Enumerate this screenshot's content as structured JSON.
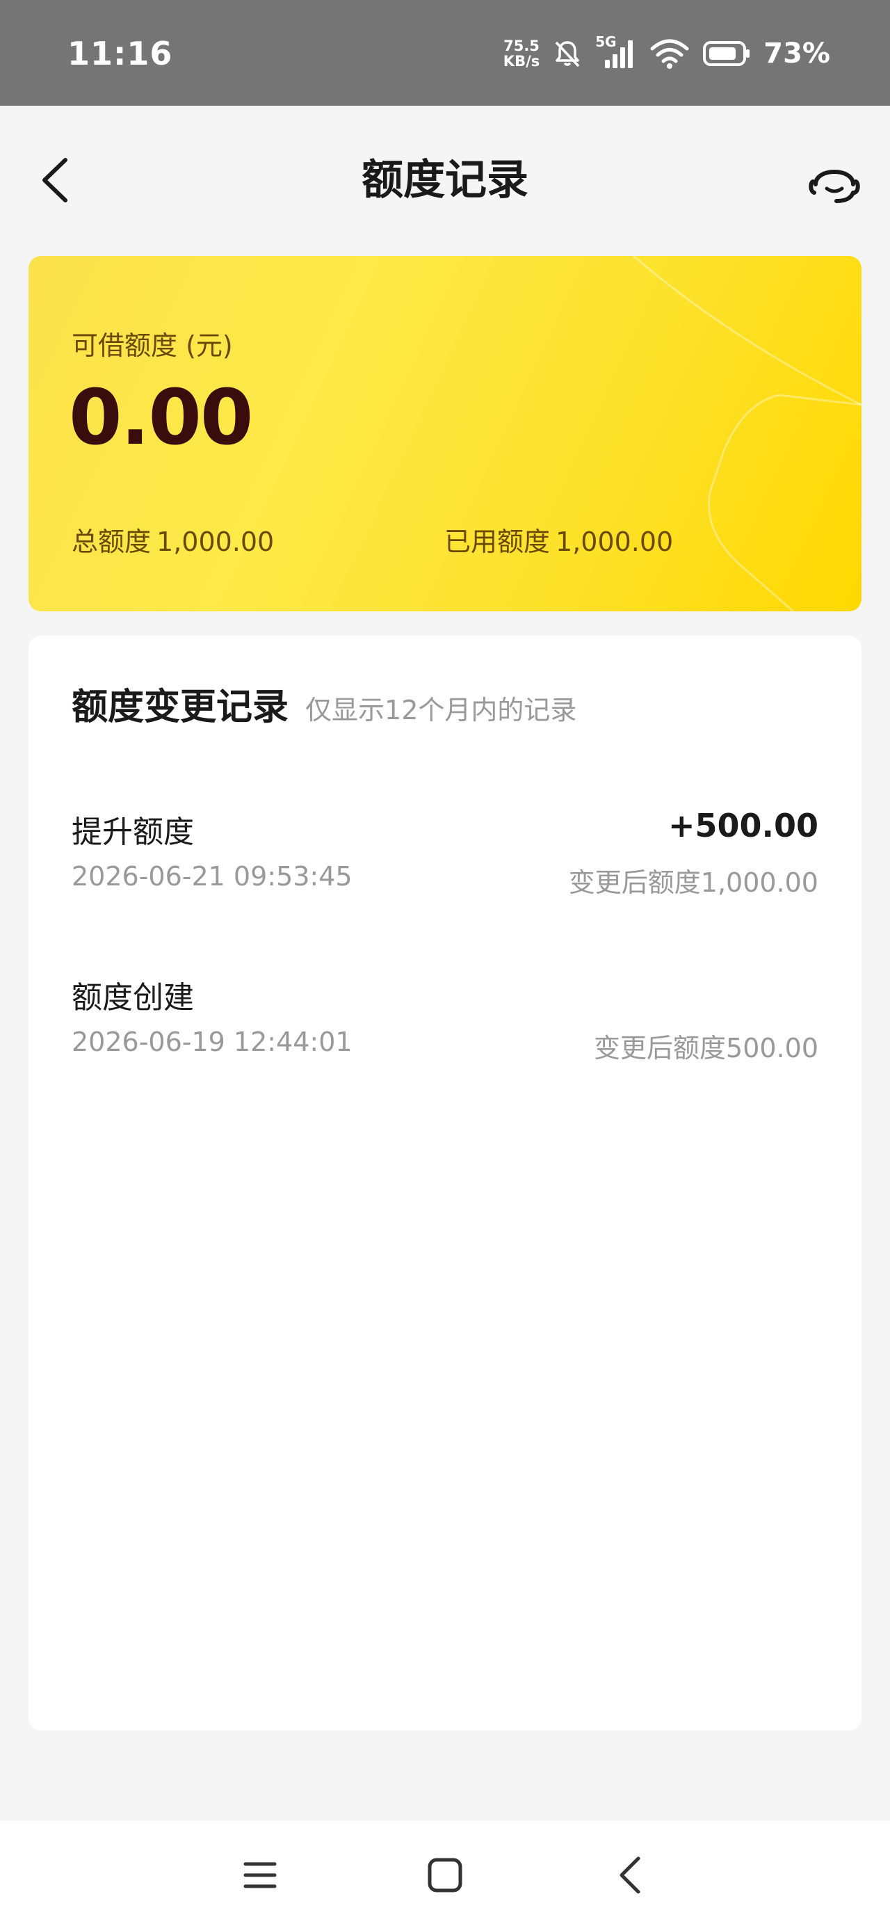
{
  "status_bar": {
    "time": "11:16",
    "net_speed_value": "75.5",
    "net_speed_unit": "KB/s",
    "network_type": "5G",
    "battery_percent": "73%"
  },
  "header": {
    "title": "额度记录"
  },
  "credit_card": {
    "available_label": "可借额度 (元)",
    "available_amount": "0.00",
    "total_label": "总额度",
    "total_value": "1,000.00",
    "used_label": "已用额度",
    "used_value": "1,000.00"
  },
  "records": {
    "title": "额度变更记录",
    "note": "仅显示12个月内的记录",
    "items": [
      {
        "name": "提升额度",
        "amount": "+500.00",
        "time": "2026-06-21 09:53:45",
        "after": "变更后额度1,000.00"
      },
      {
        "name": "额度创建",
        "amount": "",
        "time": "2026-06-19 12:44:01",
        "after": "变更后额度500.00"
      }
    ]
  },
  "icons": {
    "back": "chevron-left-icon",
    "service": "headset-icon",
    "nav_menu": "menu-icon",
    "nav_home": "square-icon",
    "nav_back": "chevron-left-icon"
  },
  "colors": {
    "status_bar": "#757575",
    "card_yellow": "#fde947",
    "amount_dark": "#3a0d0d",
    "label_brown": "#6b4a00"
  }
}
